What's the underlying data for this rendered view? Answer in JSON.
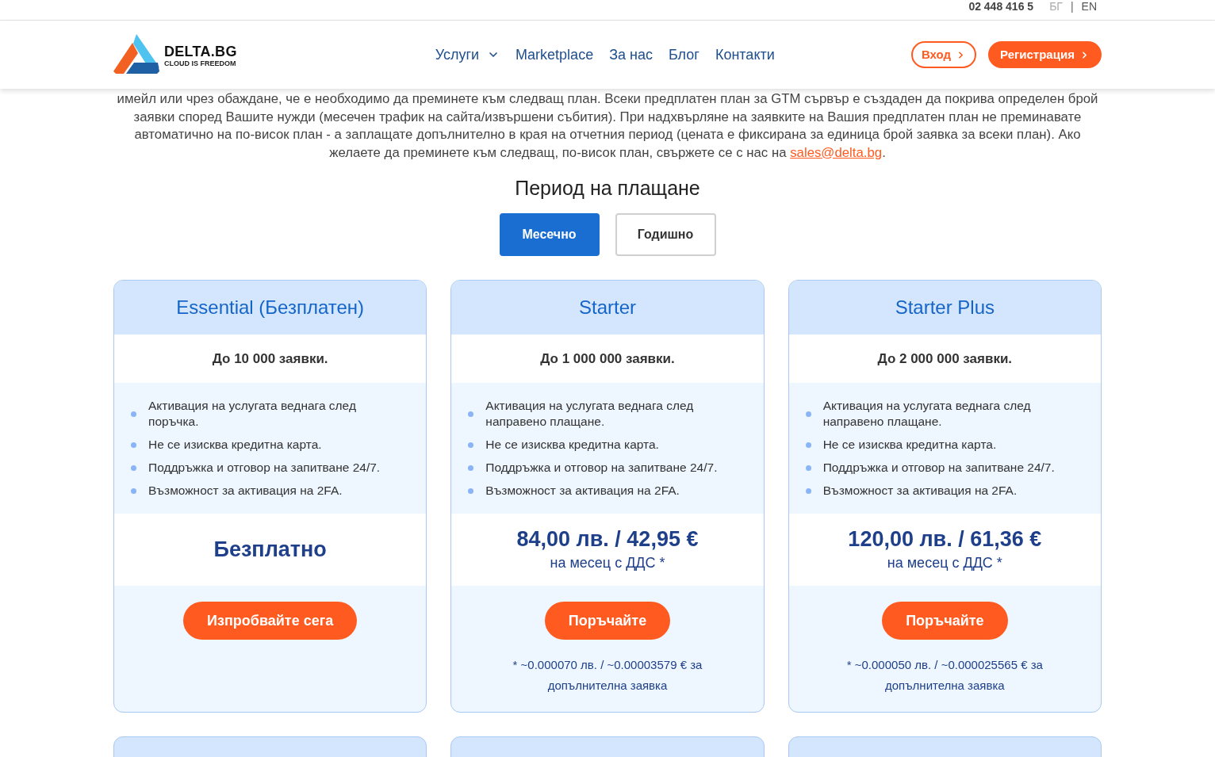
{
  "top_bar": {
    "phone": "02 448 416 5",
    "languages": [
      {
        "label": "БГ",
        "selected": true
      },
      {
        "label": "EN",
        "selected": false
      }
    ],
    "separator": "|"
  },
  "header": {
    "logo": {
      "name": "DELTA.BG",
      "tagline": "CLOUD IS FREEDOM"
    },
    "nav": [
      {
        "label": "Услуги",
        "kind": "dropdown"
      },
      {
        "label": "Marketplace",
        "kind": "link"
      },
      {
        "label": "За нас",
        "kind": "link"
      },
      {
        "label": "Блог",
        "kind": "link"
      },
      {
        "label": "Контакти",
        "kind": "link"
      }
    ],
    "login": "Вход",
    "register": "Регистрация"
  },
  "intro": {
    "text": "имейл или чрез обаждане, че е необходимо да преминете към следващ план. Всеки предплатен план за GTM сървър е създаден да покрива определен брой заявки според Вашите нужди (месечен трафик на сайта/извършени събития). При надхвърляне на заявките на Вашия предплатен план не преминавате автоматично на по-висок план - а заплащате допълнително в края на отчетния период (цената е фиксирана за единица брой заявка за всеки план). Ако желаете да преминете към следващ, по-висок план, свържете се с нас на ",
    "link": "sales@delta.bg",
    "end": "."
  },
  "billing": {
    "title": "Период на плащане",
    "options": [
      {
        "label": "Месечно",
        "selected": true
      },
      {
        "label": "Годишно",
        "selected": false
      }
    ]
  },
  "plans": [
    {
      "title": "Essential (Безплатен)",
      "requests": "До 10 000 заявки.",
      "features": [
        "Активация на услугата веднага след поръчка.",
        "Не се изисква кредитна карта.",
        "Поддръжка и отговор на запитване 24/7.",
        "Възможност за активация на 2FA."
      ],
      "price": {
        "kind": "free",
        "amount": "Безплатно"
      },
      "button": "Изпробвайте сега"
    },
    {
      "title": "Starter",
      "requests": "До 1 000 000 заявки.",
      "features": [
        "Активация на услугата веднага след направено плащане.",
        "Не се изисква кредитна карта.",
        "Поддръжка и отговор на запитване 24/7.",
        "Възможност за активация на 2FA."
      ],
      "price": {
        "kind": "paid",
        "amount": "84,00 лв. / 42,95 €",
        "period": "на месец с ДДС *"
      },
      "button": "Поръчайте",
      "footnote": "* ~0.000070 лв. / ~0.00003579 € за допълнителна заявка"
    },
    {
      "title": "Starter Plus",
      "requests": "До 2 000 000 заявки.",
      "features": [
        "Активация на услугата веднага след направено плащане.",
        "Не се изисква кредитна карта.",
        "Поддръжка и отговор на запитване 24/7.",
        "Възможност за активация на 2FA."
      ],
      "price": {
        "kind": "paid",
        "amount": "120,00 лв. / 61,36 €",
        "period": "на месец с ДДС *"
      },
      "button": "Поръчайте",
      "footnote": "* ~0.000050 лв. / ~0.000025565 € за допълнителна заявка"
    }
  ],
  "next_row": [
    {
      "kind": "card"
    },
    {
      "kind": "card"
    },
    {
      "kind": "card"
    }
  ]
}
